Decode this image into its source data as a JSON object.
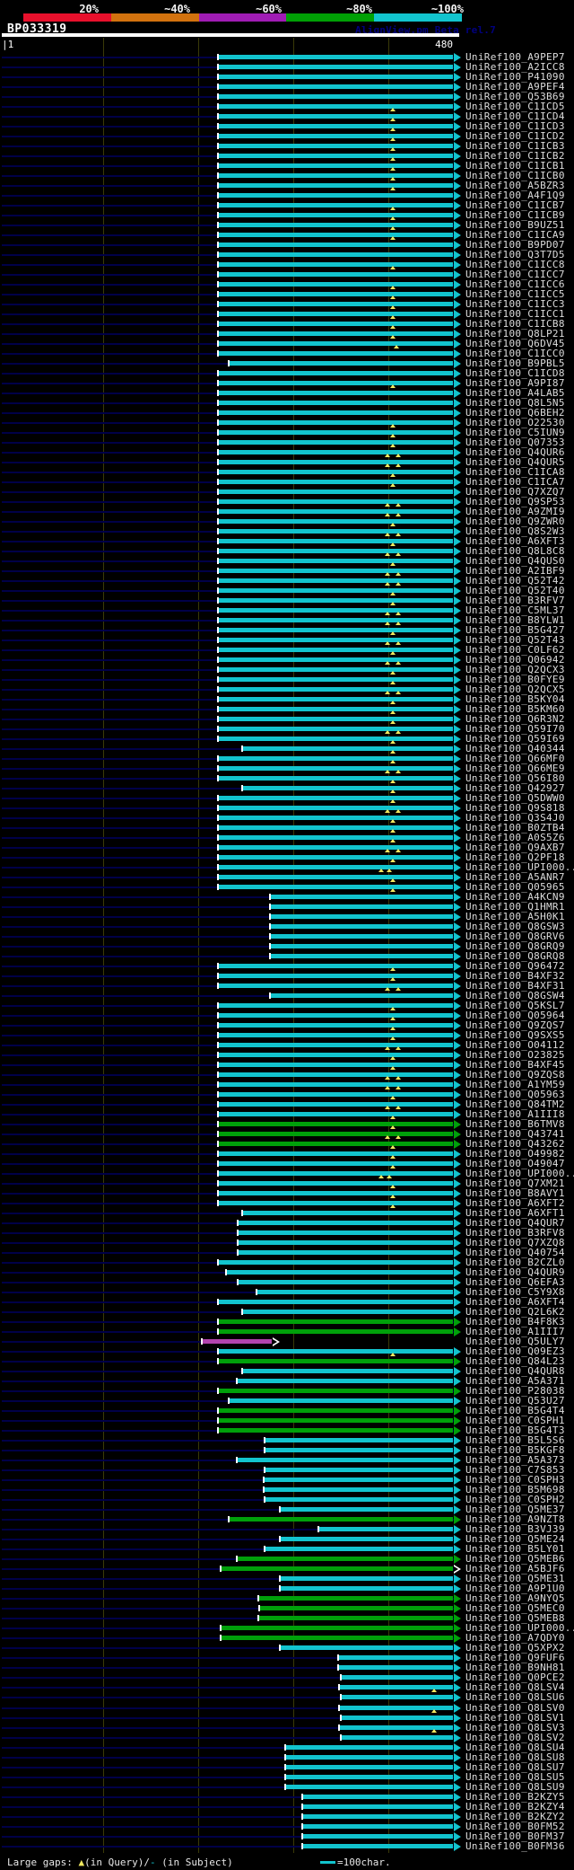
{
  "header": {
    "title": "BP033319",
    "watermark": "AlignView.pm Beta rel.7",
    "identity_scale": {
      "labels": [
        "20%",
        "~40%",
        "~60%",
        "~80%",
        "~100%"
      ],
      "segment_colors": [
        "#e8102c",
        "#d2720e",
        "#a01cb4",
        "#00a005",
        "#12c4ce"
      ]
    }
  },
  "ruler": {
    "start_label": "1",
    "end_label": "480",
    "query_length": 480
  },
  "colors": {
    "cyan_bar": "#12c4ce",
    "green_bar": "#00a00a",
    "magenta_bar": "#b344ae",
    "track_navy": "#000048",
    "gap_marker_yellow": "#f0e860",
    "gridline_olive": "#3a3a08",
    "label_text": "#dcdcdc"
  },
  "footer": {
    "large_gaps_prefix": "Large gaps: ",
    "gap_query_symbol": "▲",
    "gap_query_text": "(in Query)/",
    "gap_subject_symbol": "-",
    "gap_subject_text": " (in Subject)",
    "scale_legend": "=100char."
  },
  "row_fields": [
    "label",
    "color_key",
    "query_start",
    "query_end",
    "hollow_arrow",
    "gap_markers"
  ],
  "rows": [
    [
      "UniRef100_A9PEP7",
      "c",
      229,
      480,
      0,
      []
    ],
    [
      "UniRef100_A2ICC8",
      "c",
      229,
      480,
      0,
      []
    ],
    [
      "UniRef100_P41090",
      "c",
      229,
      480,
      0,
      []
    ],
    [
      "UniRef100_A9PEF4",
      "c",
      229,
      480,
      0,
      []
    ],
    [
      "UniRef100_Q53B69",
      "c",
      229,
      480,
      0,
      []
    ],
    [
      "UniRef100_C1ICD5",
      "c",
      229,
      480,
      0,
      [
        416
      ]
    ],
    [
      "UniRef100_C1ICD4",
      "c",
      229,
      480,
      0,
      [
        416
      ]
    ],
    [
      "UniRef100_C1ICD3",
      "c",
      229,
      480,
      0,
      [
        416
      ]
    ],
    [
      "UniRef100_C1ICD2",
      "c",
      229,
      480,
      0,
      [
        416
      ]
    ],
    [
      "UniRef100_C1ICB3",
      "c",
      229,
      480,
      0,
      [
        416
      ]
    ],
    [
      "UniRef100_C1ICB2",
      "c",
      229,
      480,
      0,
      [
        416
      ]
    ],
    [
      "UniRef100_C1ICB1",
      "c",
      229,
      480,
      0,
      [
        416
      ]
    ],
    [
      "UniRef100_C1ICB0",
      "c",
      229,
      480,
      0,
      [
        416
      ]
    ],
    [
      "UniRef100_A5BZR3",
      "c",
      229,
      480,
      0,
      [
        416
      ]
    ],
    [
      "UniRef100_A4F1Q9",
      "c",
      229,
      480,
      0,
      []
    ],
    [
      "UniRef100_C1ICB7",
      "c",
      229,
      480,
      0,
      [
        416
      ]
    ],
    [
      "UniRef100_C1ICB9",
      "c",
      229,
      480,
      0,
      [
        416
      ]
    ],
    [
      "UniRef100_B9UZ51",
      "c",
      229,
      480,
      0,
      [
        416
      ]
    ],
    [
      "UniRef100_C1ICA9",
      "c",
      229,
      480,
      0,
      [
        416
      ]
    ],
    [
      "UniRef100_B9PD07",
      "c",
      229,
      480,
      0,
      []
    ],
    [
      "UniRef100_Q3T7D5",
      "c",
      229,
      480,
      0,
      []
    ],
    [
      "UniRef100_C1ICC8",
      "c",
      229,
      480,
      0,
      [
        416
      ]
    ],
    [
      "UniRef100_C1ICC7",
      "c",
      229,
      480,
      0,
      []
    ],
    [
      "UniRef100_C1ICC6",
      "c",
      229,
      480,
      0,
      [
        416
      ]
    ],
    [
      "UniRef100_C1ICC5",
      "c",
      229,
      480,
      0,
      [
        416
      ]
    ],
    [
      "UniRef100_C1ICC3",
      "c",
      229,
      480,
      0,
      [
        416
      ]
    ],
    [
      "UniRef100_C1ICC1",
      "c",
      229,
      480,
      0,
      [
        416
      ]
    ],
    [
      "UniRef100_C1ICB8",
      "c",
      229,
      480,
      0,
      [
        416
      ]
    ],
    [
      "UniRef100_Q8LP21",
      "c",
      229,
      480,
      0,
      [
        416
      ]
    ],
    [
      "UniRef100_Q6DV45",
      "c",
      229,
      480,
      0,
      [
        420
      ]
    ],
    [
      "UniRef100_C1ICC0",
      "c",
      229,
      480,
      0,
      []
    ],
    [
      "UniRef100_B9PBL5",
      "c",
      240,
      480,
      0,
      []
    ],
    [
      "UniRef100_C1ICD8",
      "c",
      229,
      480,
      0,
      []
    ],
    [
      "UniRef100_A9PI87",
      "c",
      229,
      480,
      0,
      [
        416
      ]
    ],
    [
      "UniRef100_A4LAB5",
      "c",
      229,
      480,
      0,
      []
    ],
    [
      "UniRef100_Q8L5N5",
      "c",
      229,
      480,
      0,
      []
    ],
    [
      "UniRef100_Q6BEH2",
      "c",
      229,
      480,
      0,
      []
    ],
    [
      "UniRef100_O22530",
      "c",
      229,
      480,
      0,
      [
        416
      ]
    ],
    [
      "UniRef100_C5IUN9",
      "c",
      229,
      480,
      0,
      [
        416
      ]
    ],
    [
      "UniRef100_Q07353",
      "c",
      229,
      480,
      0,
      [
        416
      ]
    ],
    [
      "UniRef100_Q4QUR6",
      "c",
      229,
      480,
      0,
      [
        410,
        422
      ]
    ],
    [
      "UniRef100_Q4QUR5",
      "c",
      229,
      480,
      0,
      [
        410,
        422
      ]
    ],
    [
      "UniRef100_C1ICA8",
      "c",
      229,
      480,
      0,
      [
        416
      ]
    ],
    [
      "UniRef100_C1ICA7",
      "c",
      229,
      480,
      0,
      [
        416
      ]
    ],
    [
      "UniRef100_Q7XZQ7",
      "c",
      229,
      480,
      0,
      []
    ],
    [
      "UniRef100_Q9SP53",
      "c",
      229,
      480,
      0,
      [
        410,
        422
      ]
    ],
    [
      "UniRef100_A9ZMI9",
      "c",
      229,
      480,
      0,
      [
        410,
        422
      ]
    ],
    [
      "UniRef100_Q9ZWR0",
      "c",
      229,
      480,
      0,
      [
        416
      ]
    ],
    [
      "UniRef100_Q8S2W3",
      "c",
      229,
      480,
      0,
      [
        410,
        422
      ]
    ],
    [
      "UniRef100_A6XFT3",
      "c",
      229,
      480,
      0,
      [
        416
      ]
    ],
    [
      "UniRef100_Q8L8C8",
      "c",
      229,
      480,
      0,
      [
        410,
        422
      ]
    ],
    [
      "UniRef100_Q4QUS0",
      "c",
      229,
      480,
      0,
      [
        416
      ]
    ],
    [
      "UniRef100_A2IBF9",
      "c",
      229,
      480,
      0,
      [
        410,
        422
      ]
    ],
    [
      "UniRef100_Q52T42",
      "c",
      229,
      480,
      0,
      [
        410,
        422
      ]
    ],
    [
      "UniRef100_Q52T40",
      "c",
      229,
      480,
      0,
      [
        416
      ]
    ],
    [
      "UniRef100_B3RFV7",
      "c",
      229,
      480,
      0,
      [
        416
      ]
    ],
    [
      "UniRef100_C5ML37",
      "c",
      229,
      480,
      0,
      [
        410,
        422
      ]
    ],
    [
      "UniRef100_B8YLW1",
      "c",
      229,
      480,
      0,
      [
        410,
        422
      ]
    ],
    [
      "UniRef100_B5G427",
      "c",
      229,
      480,
      0,
      [
        416
      ]
    ],
    [
      "UniRef100_Q52T43",
      "c",
      229,
      480,
      0,
      [
        410,
        422
      ]
    ],
    [
      "UniRef100_C0LF62",
      "c",
      229,
      480,
      0,
      [
        416
      ]
    ],
    [
      "UniRef100_Q06942",
      "c",
      229,
      480,
      0,
      [
        410,
        422
      ]
    ],
    [
      "UniRef100_Q2QCX3",
      "c",
      229,
      480,
      0,
      [
        416
      ]
    ],
    [
      "UniRef100_B0FYE9",
      "c",
      229,
      480,
      0,
      [
        416
      ]
    ],
    [
      "UniRef100_Q2QCX5",
      "c",
      229,
      480,
      0,
      [
        410,
        422
      ]
    ],
    [
      "UniRef100_B5KY04",
      "c",
      229,
      480,
      0,
      [
        416
      ]
    ],
    [
      "UniRef100_B5KM60",
      "c",
      229,
      480,
      0,
      [
        416
      ]
    ],
    [
      "UniRef100_Q6R3N2",
      "c",
      229,
      480,
      0,
      [
        416
      ]
    ],
    [
      "UniRef100_Q59I70",
      "c",
      229,
      480,
      0,
      [
        410,
        422
      ]
    ],
    [
      "UniRef100_Q59I69",
      "c",
      229,
      480,
      0,
      [
        416
      ]
    ],
    [
      "UniRef100_Q40344",
      "c",
      255,
      480,
      0,
      [
        416
      ]
    ],
    [
      "UniRef100_Q66MF0",
      "c",
      229,
      480,
      0,
      [
        416
      ]
    ],
    [
      "UniRef100_Q66ME9",
      "c",
      229,
      480,
      0,
      [
        410,
        422
      ]
    ],
    [
      "UniRef100_Q56I80",
      "c",
      229,
      480,
      0,
      [
        416
      ]
    ],
    [
      "UniRef100_Q42927",
      "c",
      255,
      480,
      0,
      [
        416
      ]
    ],
    [
      "UniRef100_Q5DWW0",
      "c",
      229,
      480,
      0,
      [
        416
      ]
    ],
    [
      "UniRef100_Q9S818",
      "c",
      229,
      480,
      0,
      [
        410,
        422
      ]
    ],
    [
      "UniRef100_Q3S4J0",
      "c",
      229,
      480,
      0,
      [
        416
      ]
    ],
    [
      "UniRef100_B0ZTB4",
      "c",
      229,
      480,
      0,
      [
        416
      ]
    ],
    [
      "UniRef100_A0S5Z6",
      "c",
      229,
      480,
      0,
      [
        416
      ]
    ],
    [
      "UniRef100_Q9AXB7",
      "c",
      229,
      480,
      0,
      [
        410,
        422
      ]
    ],
    [
      "UniRef100_Q2PF18",
      "c",
      229,
      480,
      0,
      [
        416
      ]
    ],
    [
      "UniRef100_UPI000..",
      "c",
      229,
      480,
      0,
      [
        404,
        412
      ]
    ],
    [
      "UniRef100_A5ANR7",
      "c",
      229,
      480,
      0,
      [
        416
      ]
    ],
    [
      "UniRef100_Q05965",
      "c",
      229,
      480,
      0,
      [
        416
      ]
    ],
    [
      "UniRef100_A4KCN9",
      "c",
      284,
      480,
      0,
      []
    ],
    [
      "UniRef100_Q1HMR1",
      "c",
      284,
      480,
      0,
      []
    ],
    [
      "UniRef100_A5H0K1",
      "c",
      284,
      480,
      0,
      []
    ],
    [
      "UniRef100_Q8GSW3",
      "c",
      284,
      480,
      0,
      []
    ],
    [
      "UniRef100_Q8GRV6",
      "c",
      284,
      480,
      0,
      []
    ],
    [
      "UniRef100_Q8GRQ9",
      "c",
      284,
      480,
      0,
      []
    ],
    [
      "UniRef100_Q8GRQ8",
      "c",
      284,
      480,
      0,
      []
    ],
    [
      "UniRef100_Q96472",
      "c",
      229,
      480,
      0,
      [
        416
      ]
    ],
    [
      "UniRef100_B4XF32",
      "c",
      229,
      480,
      0,
      [
        416
      ]
    ],
    [
      "UniRef100_B4XF31",
      "c",
      229,
      480,
      0,
      [
        410,
        422
      ]
    ],
    [
      "UniRef100_Q8GSW4",
      "c",
      284,
      480,
      0,
      []
    ],
    [
      "UniRef100_Q5KSL7",
      "c",
      229,
      480,
      0,
      [
        416
      ]
    ],
    [
      "UniRef100_Q05964",
      "c",
      229,
      480,
      0,
      [
        416
      ]
    ],
    [
      "UniRef100_Q9ZQS7",
      "c",
      229,
      480,
      0,
      [
        416
      ]
    ],
    [
      "UniRef100_Q9SXS5",
      "c",
      229,
      480,
      0,
      [
        416
      ]
    ],
    [
      "UniRef100_O04112",
      "c",
      229,
      480,
      0,
      [
        410,
        422
      ]
    ],
    [
      "UniRef100_O23825",
      "c",
      229,
      480,
      0,
      [
        416
      ]
    ],
    [
      "UniRef100_B4XF45",
      "c",
      229,
      480,
      0,
      [
        416
      ]
    ],
    [
      "UniRef100_Q9ZQS8",
      "c",
      229,
      480,
      0,
      [
        410,
        422
      ]
    ],
    [
      "UniRef100_A1YM59",
      "c",
      229,
      480,
      0,
      [
        410,
        422
      ]
    ],
    [
      "UniRef100_Q05963",
      "c",
      229,
      480,
      0,
      [
        416
      ]
    ],
    [
      "UniRef100_Q84TM2",
      "c",
      229,
      480,
      0,
      [
        410,
        422
      ]
    ],
    [
      "UniRef100_A1III8",
      "c",
      229,
      480,
      0,
      [
        416
      ]
    ],
    [
      "UniRef100_B6TMV8",
      "g",
      229,
      480,
      0,
      [
        416
      ]
    ],
    [
      "UniRef100_Q43741",
      "g",
      229,
      480,
      0,
      [
        410,
        422
      ]
    ],
    [
      "UniRef100_Q43262",
      "g",
      229,
      480,
      0,
      [
        416
      ]
    ],
    [
      "UniRef100_O49982",
      "c",
      229,
      480,
      0,
      [
        416
      ]
    ],
    [
      "UniRef100_O49047",
      "c",
      229,
      480,
      0,
      [
        416
      ]
    ],
    [
      "UniRef100_UPI000..",
      "c",
      229,
      480,
      0,
      [
        404,
        412
      ]
    ],
    [
      "UniRef100_Q7XM21",
      "c",
      229,
      480,
      0,
      [
        416
      ]
    ],
    [
      "UniRef100_B8AVY1",
      "c",
      229,
      480,
      0,
      [
        416
      ]
    ],
    [
      "UniRef100_A6XFT2",
      "c",
      229,
      480,
      0,
      [
        416
      ]
    ],
    [
      "UniRef100_A6XFT1",
      "c",
      255,
      480,
      0,
      []
    ],
    [
      "UniRef100_Q4QUR7",
      "c",
      250,
      480,
      0,
      []
    ],
    [
      "UniRef100_B3RFV8",
      "c",
      250,
      480,
      0,
      []
    ],
    [
      "UniRef100_Q7XZQ8",
      "c",
      250,
      480,
      0,
      []
    ],
    [
      "UniRef100_Q40754",
      "c",
      250,
      480,
      0,
      []
    ],
    [
      "UniRef100_B2CZL0",
      "c",
      229,
      480,
      0,
      []
    ],
    [
      "UniRef100_Q4QUR9",
      "c",
      238,
      480,
      0,
      []
    ],
    [
      "UniRef100_Q6EFA3",
      "c",
      250,
      480,
      0,
      []
    ],
    [
      "UniRef100_C5Y9X8",
      "c",
      270,
      480,
      0,
      []
    ],
    [
      "UniRef100_A6XFT4",
      "c",
      229,
      480,
      0,
      []
    ],
    [
      "UniRef100_Q2L6K2",
      "c",
      255,
      480,
      0,
      []
    ],
    [
      "UniRef100_B4F8K3",
      "g",
      229,
      480,
      0,
      []
    ],
    [
      "UniRef100_A1III7",
      "g",
      229,
      480,
      0,
      []
    ],
    [
      "UniRef100_Q5ULY7",
      "m",
      212,
      287,
      1,
      []
    ],
    [
      "UniRef100_Q09EZ3",
      "c",
      229,
      480,
      0,
      [
        416
      ]
    ],
    [
      "UniRef100_Q84L23",
      "g",
      229,
      480,
      0,
      []
    ],
    [
      "UniRef100_Q4QUR8",
      "c",
      255,
      480,
      0,
      []
    ],
    [
      "UniRef100_A5A371",
      "c",
      249,
      480,
      0,
      []
    ],
    [
      "UniRef100_P28038",
      "g",
      229,
      480,
      0,
      []
    ],
    [
      "UniRef100_Q53U27",
      "c",
      240,
      480,
      0,
      []
    ],
    [
      "UniRef100_B5G4T4",
      "g",
      229,
      480,
      0,
      []
    ],
    [
      "UniRef100_C0SPH1",
      "g",
      229,
      480,
      0,
      []
    ],
    [
      "UniRef100_B5G4T3",
      "g",
      229,
      480,
      0,
      []
    ],
    [
      "UniRef100_B5L5S6",
      "c",
      279,
      480,
      0,
      []
    ],
    [
      "UniRef100_B5KGF8",
      "c",
      279,
      480,
      0,
      []
    ],
    [
      "UniRef100_A5A373",
      "c",
      249,
      480,
      0,
      []
    ],
    [
      "UniRef100_C7S853",
      "c",
      279,
      480,
      0,
      []
    ],
    [
      "UniRef100_C0SPH3",
      "c",
      278,
      480,
      0,
      []
    ],
    [
      "UniRef100_B5M698",
      "c",
      278,
      480,
      0,
      []
    ],
    [
      "UniRef100_C0SPH2",
      "c",
      279,
      480,
      0,
      []
    ],
    [
      "UniRef100_Q5ME37",
      "c",
      295,
      480,
      0,
      []
    ],
    [
      "UniRef100_A9NZT8",
      "g",
      240,
      480,
      0,
      []
    ],
    [
      "UniRef100_B3VJ39",
      "c",
      336,
      480,
      0,
      []
    ],
    [
      "UniRef100_Q5ME24",
      "c",
      295,
      480,
      0,
      []
    ],
    [
      "UniRef100_B5LY01",
      "c",
      279,
      480,
      0,
      []
    ],
    [
      "UniRef100_Q5MEB6",
      "g",
      249,
      480,
      0,
      []
    ],
    [
      "UniRef100_A5BJF6",
      "g",
      232,
      480,
      1,
      []
    ],
    [
      "UniRef100_Q5ME31",
      "c",
      295,
      480,
      0,
      []
    ],
    [
      "UniRef100_A9P1U0",
      "c",
      295,
      480,
      0,
      []
    ],
    [
      "UniRef100_A9NYQ5",
      "g",
      272,
      480,
      0,
      []
    ],
    [
      "UniRef100_Q5MEC0",
      "g",
      273,
      480,
      0,
      []
    ],
    [
      "UniRef100_Q5MEB8",
      "g",
      272,
      480,
      0,
      []
    ],
    [
      "UniRef100_UPI000..",
      "g",
      232,
      480,
      0,
      []
    ],
    [
      "UniRef100_A7QDY0",
      "g",
      232,
      480,
      0,
      []
    ],
    [
      "UniRef100_Q5XPX2",
      "c",
      295,
      480,
      0,
      []
    ],
    [
      "UniRef100_Q9FUF6",
      "c",
      357,
      480,
      0,
      []
    ],
    [
      "UniRef100_B9NH81",
      "c",
      357,
      480,
      0,
      []
    ],
    [
      "UniRef100_Q0PCE2",
      "c",
      360,
      480,
      0,
      []
    ],
    [
      "UniRef100_Q8LSV4",
      "c",
      358,
      480,
      0,
      [
        460
      ]
    ],
    [
      "UniRef100_Q8LSU6",
      "c",
      360,
      480,
      0,
      []
    ],
    [
      "UniRef100_Q8LSV0",
      "c",
      358,
      480,
      0,
      [
        460
      ]
    ],
    [
      "UniRef100_Q8LSV1",
      "c",
      360,
      480,
      0,
      []
    ],
    [
      "UniRef100_Q8LSV3",
      "c",
      358,
      480,
      0,
      [
        460
      ]
    ],
    [
      "UniRef100_Q8LSV2",
      "c",
      360,
      480,
      0,
      []
    ],
    [
      "UniRef100_Q8LSU4",
      "c",
      301,
      480,
      0,
      []
    ],
    [
      "UniRef100_Q8LSU8",
      "c",
      301,
      480,
      0,
      []
    ],
    [
      "UniRef100_Q8LSU7",
      "c",
      301,
      480,
      0,
      []
    ],
    [
      "UniRef100_Q8LSU5",
      "c",
      301,
      480,
      0,
      []
    ],
    [
      "UniRef100_Q8LSU9",
      "c",
      301,
      480,
      0,
      []
    ],
    [
      "UniRef100_B2KZY5",
      "c",
      319,
      480,
      0,
      []
    ],
    [
      "UniRef100_B2KZY4",
      "c",
      319,
      480,
      0,
      []
    ],
    [
      "UniRef100_B2KZY2",
      "c",
      319,
      480,
      0,
      []
    ],
    [
      "UniRef100_B0FM52",
      "c",
      319,
      480,
      0,
      []
    ],
    [
      "UniRef100_B0FM37",
      "c",
      319,
      480,
      0,
      []
    ],
    [
      "UniRef100_B0FM36",
      "c",
      319,
      480,
      0,
      []
    ]
  ]
}
